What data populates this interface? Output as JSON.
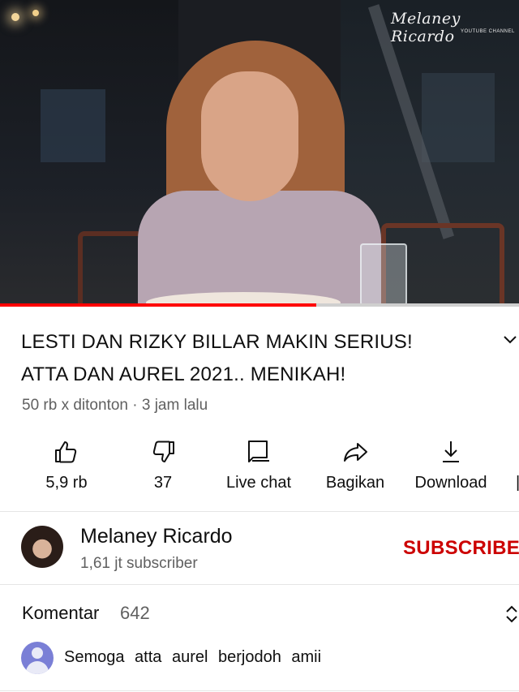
{
  "video": {
    "watermark": "Melaney Ricardo",
    "watermark_sub": "YOUTUBE CHANNEL",
    "progress": 0.61
  },
  "title": {
    "line1": "LESTI DAN RIZKY BILLAR MAKIN SERIUS!",
    "line2": "ATTA DAN AUREL 2021.. MENIKAH!"
  },
  "meta": "50 rb x ditonton · 3 jam lalu",
  "actions": [
    {
      "label": "5,9 rb",
      "icon": "thumbs-up-icon"
    },
    {
      "label": "37",
      "icon": "thumbs-down-icon"
    },
    {
      "label": "Live chat",
      "icon": "chat-icon"
    },
    {
      "label": "Bagikan",
      "icon": "share-icon"
    },
    {
      "label": "Download",
      "icon": "download-icon"
    }
  ],
  "channel": {
    "name": "Melaney Ricardo",
    "subscribers": "1,61 jt subscriber",
    "subscribe_label": "SUBSCRIBE"
  },
  "comments": {
    "label": "Komentar",
    "count": "642",
    "top_comment": "Semoga atta aurel berjodoh amii"
  },
  "colors": {
    "accent": "#ff0000",
    "subscribe": "#cc0000",
    "secondary_text": "#606060"
  }
}
